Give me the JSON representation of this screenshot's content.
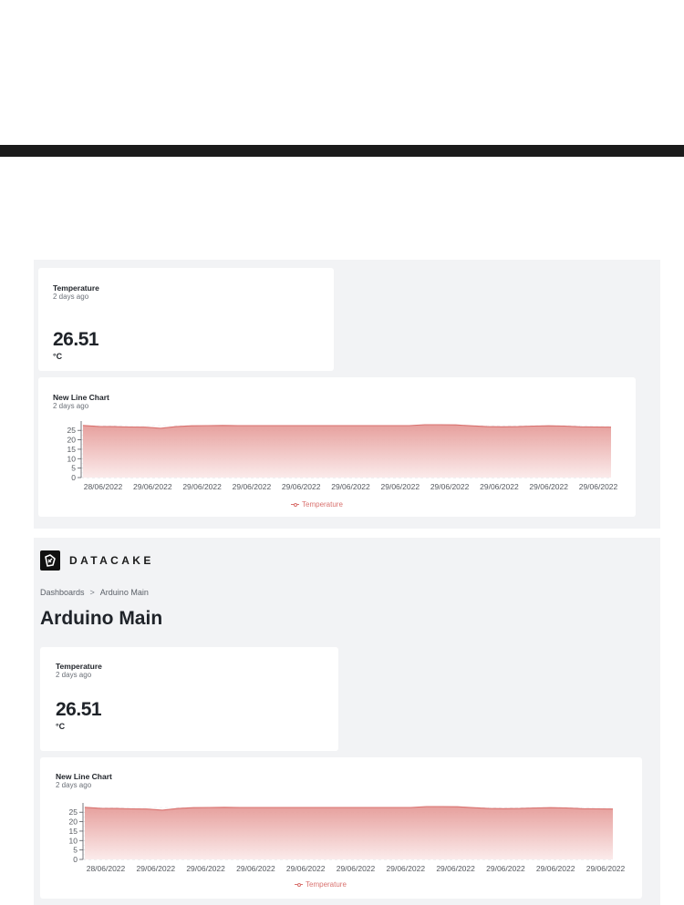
{
  "dashboard_preview": {
    "value_widget": {
      "title": "Temperature",
      "subtitle": "2 days ago",
      "value": "26.51",
      "unit": "°C"
    },
    "chart_widget": {
      "title": "New Line Chart",
      "subtitle": "2 days ago"
    }
  },
  "dashboard": {
    "brand": "DATACAKE",
    "breadcrumb": [
      "Dashboards",
      "Arduino Main"
    ],
    "breadcrumb_separator": ">",
    "page_title": "Arduino Main",
    "value_widget": {
      "title": "Temperature",
      "subtitle": "2 days ago",
      "value": "26.51",
      "unit": "°C"
    },
    "chart_widget": {
      "title": "New Line Chart",
      "subtitle": "2 days ago"
    }
  },
  "colors": {
    "series_line": "#d9726f",
    "series_fill_top": "#e59b98",
    "series_fill_bottom": "#fbeaea",
    "panel_bg": "#f2f3f5",
    "top_bar": "#1b1b1b"
  },
  "chart_data": [
    {
      "type": "area",
      "title": "New Line Chart",
      "subtitle": "2 days ago",
      "x_tick_labels": [
        "28/06/2022",
        "29/06/2022",
        "29/06/2022",
        "29/06/2022",
        "29/06/2022",
        "29/06/2022",
        "29/06/2022",
        "29/06/2022",
        "29/06/2022",
        "29/06/2022",
        "29/06/2022"
      ],
      "y_ticks": [
        0,
        5,
        10,
        15,
        20,
        25
      ],
      "ylim": [
        0,
        28
      ],
      "grid": "horizontal dashed",
      "legend_position": "bottom-center",
      "series": [
        {
          "name": "Temperature",
          "values": [
            27.6,
            27.1,
            27.0,
            26.8,
            26.7,
            26.1,
            27.0,
            27.4,
            27.5,
            27.6,
            27.5,
            27.5,
            27.5,
            27.5,
            27.5,
            27.5,
            27.5,
            27.5,
            27.5,
            27.5,
            27.5,
            27.5,
            28.0,
            28.0,
            27.9,
            27.4,
            27.0,
            26.9,
            27.0,
            27.3,
            27.4,
            27.3,
            26.9,
            26.8,
            26.7
          ]
        }
      ]
    },
    {
      "type": "area",
      "title": "New Line Chart",
      "subtitle": "2 days ago",
      "x_tick_labels": [
        "28/06/2022",
        "29/06/2022",
        "29/06/2022",
        "29/06/2022",
        "29/06/2022",
        "29/06/2022",
        "29/06/2022",
        "29/06/2022",
        "29/06/2022",
        "29/06/2022",
        "29/06/2022"
      ],
      "y_ticks": [
        0,
        5,
        10,
        15,
        20,
        25
      ],
      "ylim": [
        0,
        28
      ],
      "grid": "horizontal dashed",
      "legend_position": "bottom-center",
      "series": [
        {
          "name": "Temperature",
          "values": [
            27.6,
            27.1,
            27.0,
            26.8,
            26.7,
            26.1,
            27.0,
            27.4,
            27.5,
            27.6,
            27.5,
            27.5,
            27.5,
            27.5,
            27.5,
            27.5,
            27.5,
            27.5,
            27.5,
            27.5,
            27.5,
            27.5,
            28.0,
            28.0,
            27.9,
            27.4,
            27.0,
            26.9,
            27.0,
            27.3,
            27.4,
            27.3,
            26.9,
            26.8,
            26.7
          ]
        }
      ]
    }
  ]
}
